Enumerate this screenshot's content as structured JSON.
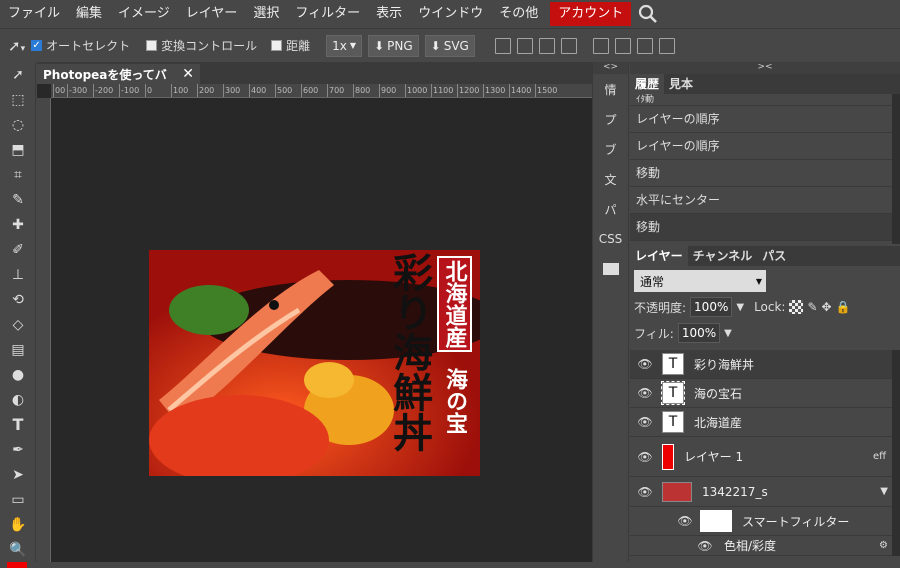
{
  "menu": [
    "ファイル",
    "編集",
    "イメージ",
    "レイヤー",
    "選択",
    "フィルター",
    "表示",
    "ウインドウ",
    "その他"
  ],
  "menu_account": "アカウント",
  "options": {
    "auto_select": "オートセレクト",
    "transform_controls": "変換コントロール",
    "distances": "距離",
    "scale": "1x",
    "png": "PNG",
    "svg": "SVG"
  },
  "doc_tab": "Photopeaを使ってバ",
  "ruler": [
    "00",
    "-300",
    "-200",
    "-100",
    "0",
    "100",
    "200",
    "300",
    "400",
    "500",
    "600",
    "700",
    "800",
    "900",
    "1000",
    "1100",
    "1200",
    "1300",
    "1400",
    "1500"
  ],
  "canvas_text": {
    "title": "彩り海鮮丼",
    "region": "北海道産",
    "sub": "海の宝"
  },
  "left_dock": [
    "情",
    "プ",
    "ブ",
    "文",
    "パ",
    "CSS"
  ],
  "history_tabs": [
    "履歴",
    "見本"
  ],
  "history": [
    "ｲﾀ動",
    "レイヤーの順序",
    "レイヤーの順序",
    "移動",
    "水平にセンター",
    "移動"
  ],
  "layer_tabs": [
    "レイヤー",
    "チャンネル",
    "パス"
  ],
  "blend_mode": "通常",
  "opacity_label": "不透明度:",
  "opacity": "100%",
  "lock_label": "Lock:",
  "fill_label": "フィル:",
  "fill": "100%",
  "layers": [
    {
      "name": "彩り海鮮丼",
      "kind": "text"
    },
    {
      "name": "海の宝石",
      "kind": "text"
    },
    {
      "name": "北海道産",
      "kind": "text"
    },
    {
      "name": "レイヤー 1",
      "kind": "red"
    },
    {
      "name": "1342217_s",
      "kind": "image"
    },
    {
      "name": "スマートフィルター",
      "kind": "smart"
    },
    {
      "name": "色相/彩度",
      "kind": "filter"
    }
  ],
  "eff_label": "eff",
  "colors": {
    "account": "#c50e0e",
    "canvas_red": "#a1181c"
  }
}
